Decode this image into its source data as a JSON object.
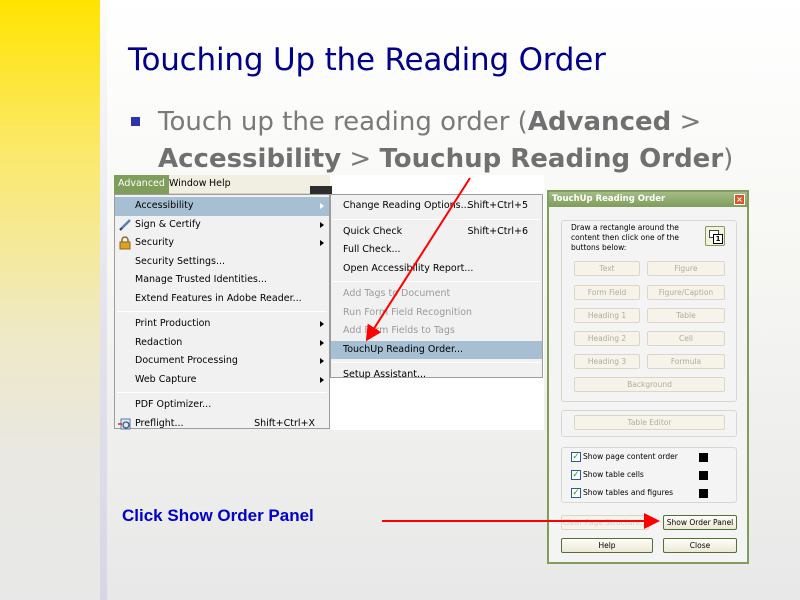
{
  "slide": {
    "title": "Touching Up the Reading Order",
    "bullet": {
      "text_before": "Touch up the reading order (",
      "bold1": "Advanced",
      "sep1": " > ",
      "bold2": "Accessibility",
      "sep2": " > ",
      "bold3": "Touchup Reading Order",
      "text_after": ")"
    },
    "callout": "Click Show Order Panel",
    "colors": {
      "title": "#00008b",
      "callout": "#0000cc",
      "arrow": "#ff0000",
      "accent_bar": "#ffe400"
    }
  },
  "menubar": {
    "items": [
      "Advanced",
      "Window",
      "Help"
    ],
    "active": "Advanced"
  },
  "advanced_menu": {
    "groups": [
      [
        {
          "label": "Accessibility",
          "submenu": true,
          "selected": true,
          "icon": null
        },
        {
          "label": "Sign & Certify",
          "submenu": true,
          "icon": "pen-icon"
        },
        {
          "label": "Security",
          "submenu": true,
          "icon": "lock-icon"
        },
        {
          "label": "Security Settings...",
          "submenu": false
        },
        {
          "label": "Manage Trusted Identities...",
          "submenu": false
        },
        {
          "label": "Extend Features in Adobe Reader...",
          "submenu": false
        }
      ],
      [
        {
          "label": "Print Production",
          "submenu": true
        },
        {
          "label": "Redaction",
          "submenu": true
        },
        {
          "label": "Document Processing",
          "submenu": true
        },
        {
          "label": "Web Capture",
          "submenu": true
        }
      ],
      [
        {
          "label": "PDF Optimizer...",
          "submenu": false
        },
        {
          "label": "Preflight...",
          "shortcut": "Shift+Ctrl+X",
          "icon": "preflight-icon"
        }
      ]
    ]
  },
  "accessibility_submenu": {
    "groups": [
      [
        {
          "label": "Change Reading Options...",
          "shortcut": "Shift+Ctrl+5"
        }
      ],
      [
        {
          "label": "Quick Check",
          "shortcut": "Shift+Ctrl+6"
        },
        {
          "label": "Full Check..."
        },
        {
          "label": "Open Accessibility Report..."
        }
      ],
      [
        {
          "label": "Add Tags to Document",
          "disabled": true
        },
        {
          "label": "Run Form Field Recognition",
          "disabled": true
        },
        {
          "label": "Add Form Fields to Tags",
          "disabled": true
        },
        {
          "label": "TouchUp Reading Order...",
          "selected": true
        }
      ],
      [
        {
          "label": "Setup Assistant..."
        }
      ]
    ]
  },
  "dialog": {
    "title": "TouchUp Reading Order",
    "instructions": "Draw a rectangle around the content then click one of the buttons below:",
    "tag_buttons": [
      "Text",
      "Figure",
      "Form Field",
      "Figure/Caption",
      "Heading 1",
      "Table",
      "Heading 2",
      "Cell",
      "Heading 3",
      "Formula"
    ],
    "background_button": "Background",
    "table_editor_button": "Table Editor",
    "checkboxes": [
      {
        "label": "Show page content order",
        "checked": true,
        "color": "#000000"
      },
      {
        "label": "Show table cells",
        "checked": true,
        "color": "#000000"
      },
      {
        "label": "Show tables and figures",
        "checked": true,
        "color": "#000000"
      }
    ],
    "clear_button": "Clear Page Structure...",
    "show_order_panel_button": "Show Order Panel",
    "help_button": "Help",
    "close_button": "Close"
  }
}
